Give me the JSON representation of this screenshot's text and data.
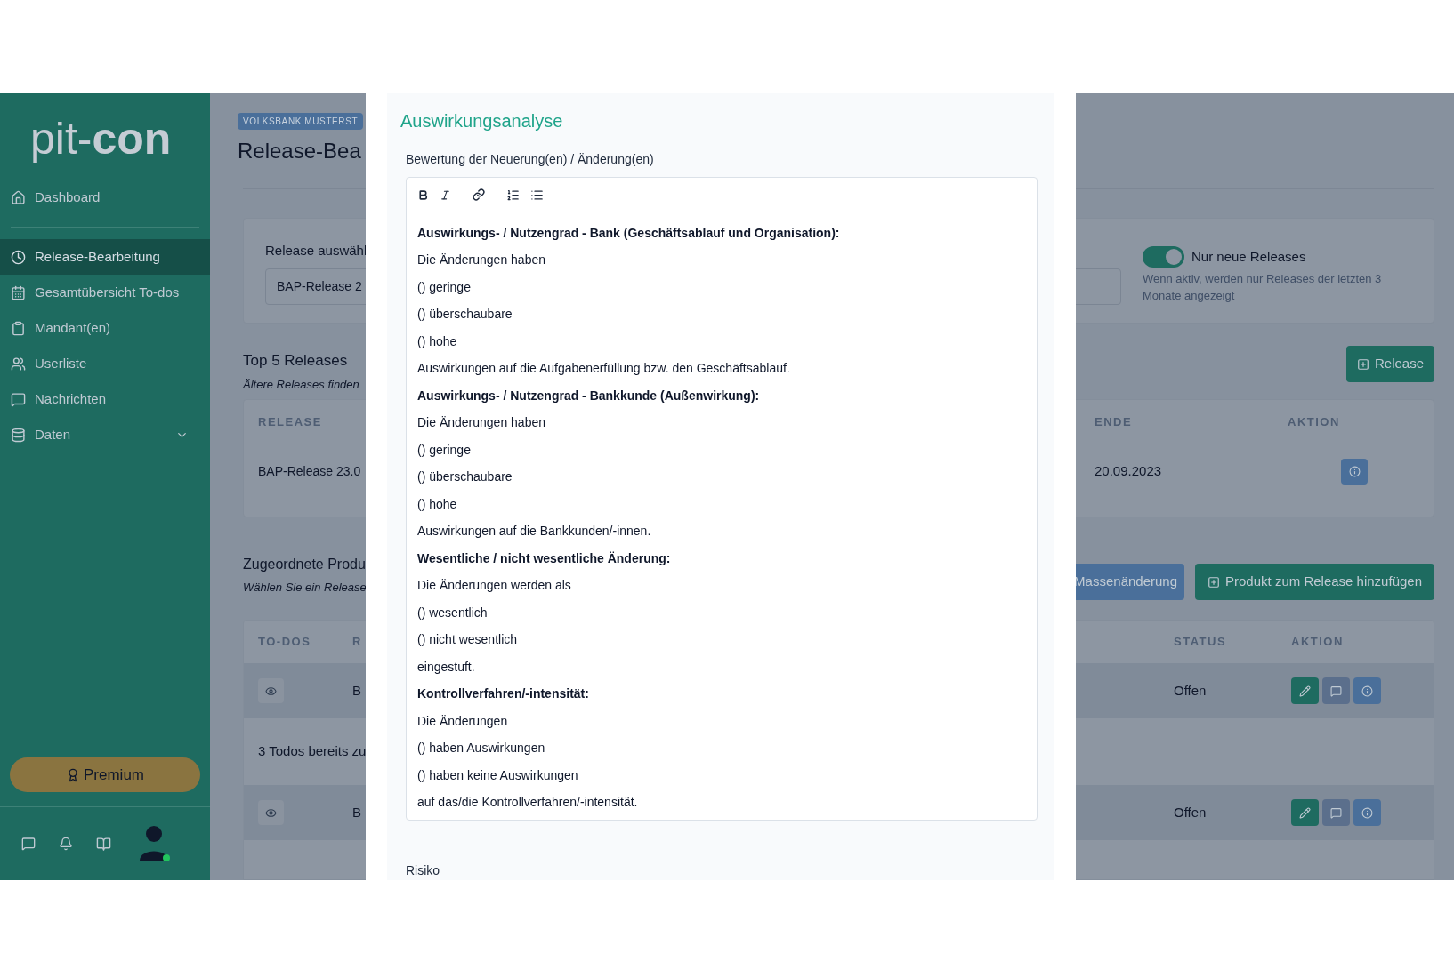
{
  "sidebar": {
    "logo": {
      "light": "pit-",
      "bold": "con"
    },
    "items": [
      {
        "label": "Dashboard",
        "selected": false
      },
      {
        "label": "Release-Bearbeitung",
        "selected": true
      },
      {
        "label": "Gesamtübersicht To-dos",
        "selected": false
      },
      {
        "label": "Mandant(en)",
        "selected": false
      },
      {
        "label": "Userliste",
        "selected": false
      },
      {
        "label": "Nachrichten",
        "selected": false
      },
      {
        "label": "Daten",
        "selected": false,
        "expanded": false
      }
    ],
    "premium_button": "Premium"
  },
  "header": {
    "badge": "VOLKSBANK MUSTERST",
    "title": "Release-Bea"
  },
  "release_select": {
    "label": "Release auswähl",
    "value": "BAP-Release 2",
    "toggle": {
      "label": "Nur neue Releases",
      "on": true,
      "hint": "Wenn aktiv, werden nur Releases der letzten 3 Monate angezeigt"
    }
  },
  "top_releases": {
    "title": "Top 5 Releases",
    "subtitle": "Ältere Releases finden",
    "button": "Release",
    "columns": [
      "RELEASE",
      "ENDE",
      "AKTION"
    ],
    "rows": [
      {
        "release": "BAP-Release 23.0",
        "ende": "20.09.2023"
      }
    ]
  },
  "products": {
    "title": "Zugeordnete Produ",
    "subtitle": "Wählen Sie ein Release",
    "buttons": [
      "Massenänderung",
      "Produkt zum Release hinzufügen"
    ],
    "columns": [
      "TO-DOS",
      "R",
      "STATUS",
      "AKTION"
    ],
    "rows": [
      {
        "kind": "product",
        "column_2": "B",
        "status": "Offen"
      },
      {
        "kind": "note",
        "text": "3 Todos bereits zu"
      },
      {
        "kind": "product",
        "column_2": "B",
        "status": "Offen"
      }
    ]
  },
  "modal": {
    "title": "Auswirkungsanalyse",
    "field_label": "Bewertung der Neuerung(en) / Änderung(en)",
    "lines": [
      {
        "kind": "heading",
        "text": "Auswirkungs- / Nutzengrad - Bank (Geschäftsablauf und Organisation):"
      },
      {
        "kind": "text",
        "text": "Die Änderungen haben"
      },
      {
        "kind": "text",
        "text": "() geringe"
      },
      {
        "kind": "text",
        "text": "() überschaubare"
      },
      {
        "kind": "text",
        "text": "() hohe"
      },
      {
        "kind": "text",
        "text": "Auswirkungen auf die Aufgabenerfüllung bzw. den Geschäftsablauf."
      },
      {
        "kind": "heading",
        "text": "Auswirkungs- / Nutzengrad - Bankkunde (Außenwirkung):"
      },
      {
        "kind": "text",
        "text": "Die Änderungen haben"
      },
      {
        "kind": "text",
        "text": "() geringe"
      },
      {
        "kind": "text",
        "text": "() überschaubare"
      },
      {
        "kind": "text",
        "text": "() hohe"
      },
      {
        "kind": "text",
        "text": "Auswirkungen auf die Bankkunden/-innen."
      },
      {
        "kind": "heading",
        "text": "Wesentliche / nicht wesentliche Änderung:"
      },
      {
        "kind": "text",
        "text": "Die Änderungen werden als"
      },
      {
        "kind": "text",
        "text": "() wesentlich"
      },
      {
        "kind": "text",
        "text": "() nicht wesentlich"
      },
      {
        "kind": "text",
        "text": "eingestuft."
      },
      {
        "kind": "heading",
        "text": "Kontrollverfahren/-intensität:"
      },
      {
        "kind": "text",
        "text": "Die Änderungen"
      },
      {
        "kind": "text",
        "text": "() haben Auswirkungen"
      },
      {
        "kind": "text",
        "text": "() haben keine Auswirkungen"
      },
      {
        "kind": "text",
        "text": "auf das/die Kontrollverfahren/-intensität."
      }
    ],
    "next_label": "Risiko"
  }
}
